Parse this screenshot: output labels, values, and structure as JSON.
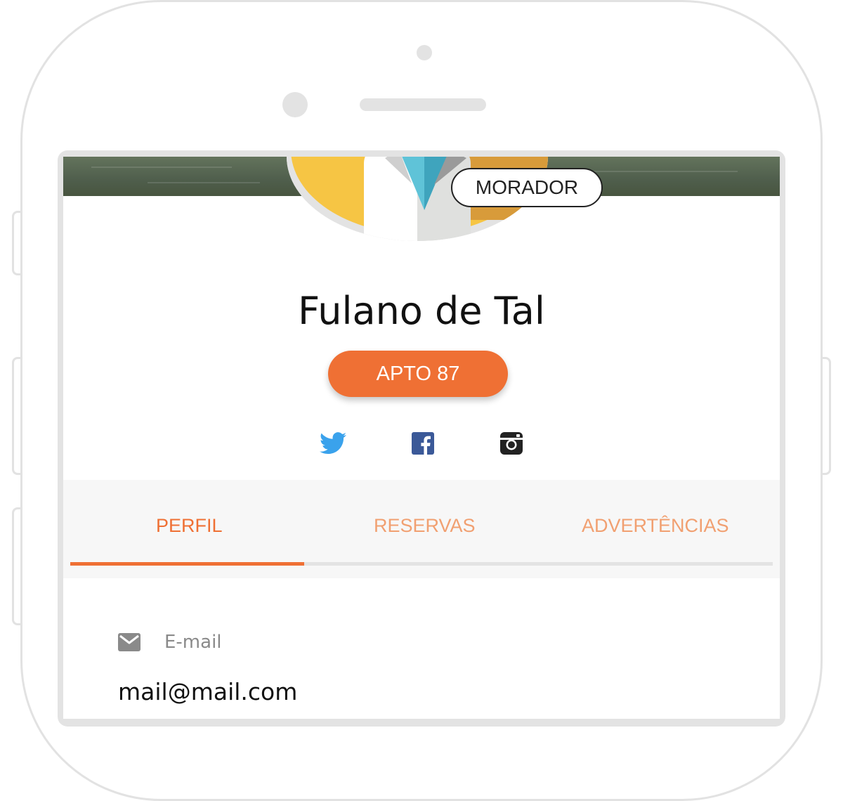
{
  "profile": {
    "role": "MORADOR",
    "name": "Fulano de Tal",
    "apartment": "APTO 87"
  },
  "social": {
    "items": [
      {
        "icon": "twitter-icon",
        "color": "#3aa2ec"
      },
      {
        "icon": "facebook-icon",
        "color": "#3b5998"
      },
      {
        "icon": "instagram-icon",
        "color": "#222222"
      }
    ]
  },
  "tabs": [
    {
      "label": "PERFIL",
      "active": true
    },
    {
      "label": "RESERVAS",
      "active": false
    },
    {
      "label": "ADVERTÊNCIAS",
      "active": false
    }
  ],
  "fields": {
    "email": {
      "label": "E-mail",
      "value": "mail@mail.com",
      "icon": "mail-icon"
    }
  },
  "colors": {
    "accent": "#ef7034",
    "tab_active": "#ef7034",
    "tab_inactive": "#f1a071"
  }
}
